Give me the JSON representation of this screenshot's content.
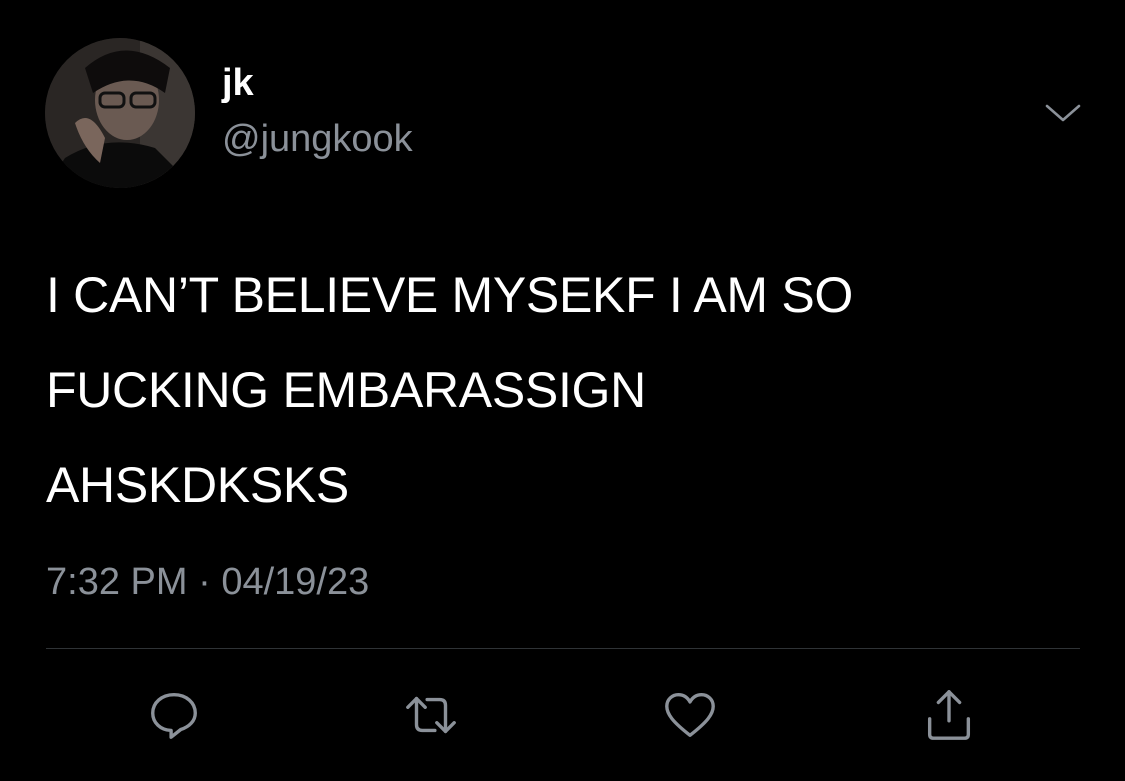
{
  "tweet": {
    "author": {
      "display_name": "jk",
      "handle": "@jungkook",
      "avatar_icon": "profile-photo"
    },
    "text_lines": [
      "I CAN’T BELIEVE MYSEKF I AM SO",
      "FUCKING EMBARASSIGN",
      "AHSKDKSKS"
    ],
    "time": "7:32 PM",
    "separator": "·",
    "date": "04/19/23"
  },
  "actions": [
    {
      "name": "reply",
      "icon": "comment-icon"
    },
    {
      "name": "retweet",
      "icon": "retweet-icon"
    },
    {
      "name": "like",
      "icon": "heart-icon"
    },
    {
      "name": "share",
      "icon": "share-icon"
    }
  ],
  "colors": {
    "background": "#000000",
    "text_primary": "#ffffff",
    "text_secondary": "#8b9199",
    "divider": "#2f3336",
    "icon": "#8b9199"
  }
}
